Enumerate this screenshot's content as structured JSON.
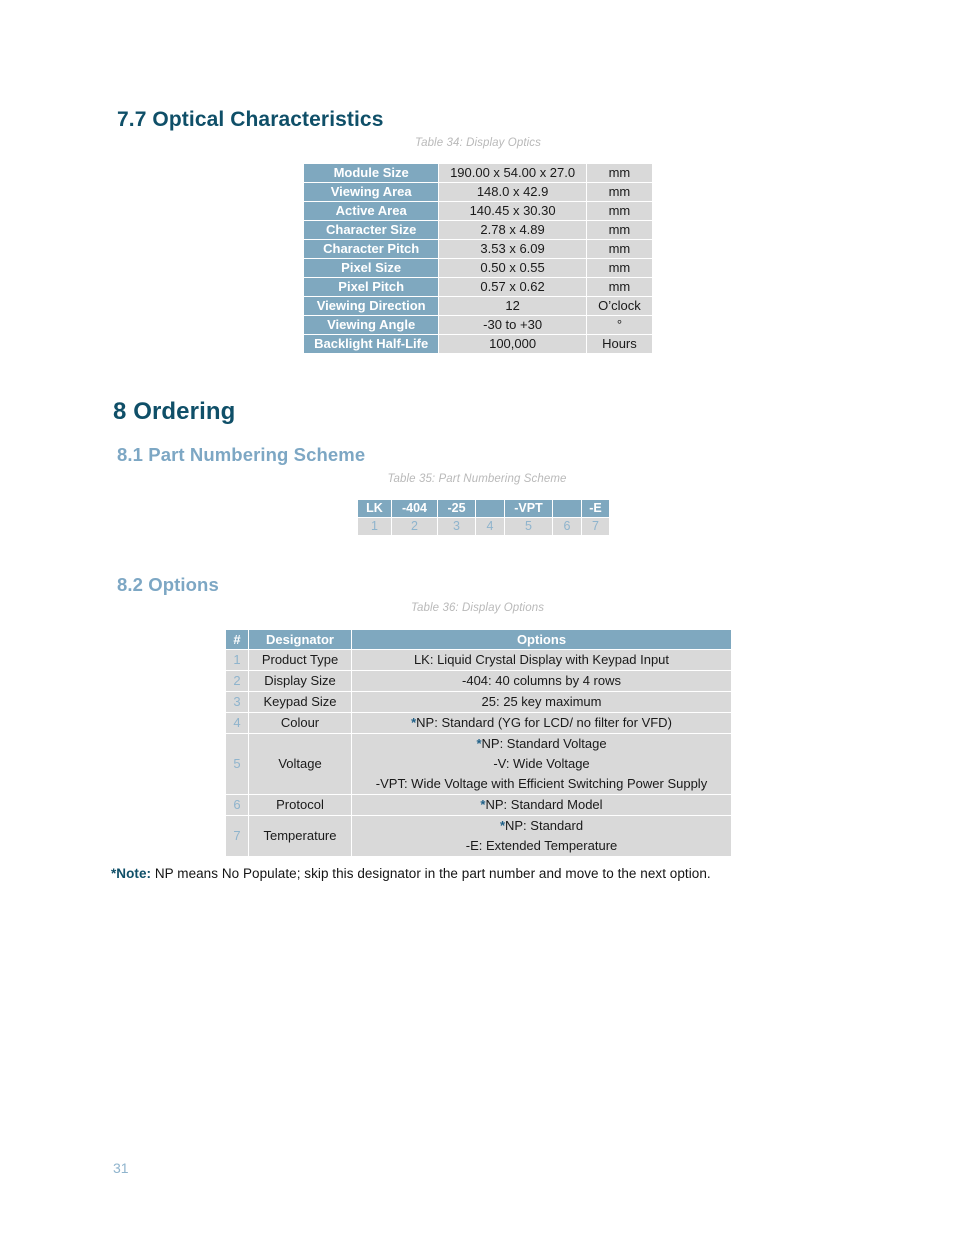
{
  "sections": {
    "optical": {
      "number": "7.7",
      "title": "Optical Characteristics",
      "heading": "7.7 Optical Characteristics"
    },
    "ordering": {
      "number": "8",
      "title": "Ordering",
      "heading": "8 Ordering"
    },
    "part_numbering": {
      "number": "8.1",
      "title": "Part Numbering Scheme",
      "heading": "8.1 Part Numbering Scheme"
    },
    "options": {
      "number": "8.2",
      "title": "Options",
      "heading": "8.2 Options"
    }
  },
  "table34": {
    "caption": "Table 34: Display Optics",
    "rows": [
      {
        "label": "Module Size",
        "value": "190.00 x 54.00 x 27.0",
        "unit": "mm"
      },
      {
        "label": "Viewing Area",
        "value": "148.0 x 42.9",
        "unit": "mm"
      },
      {
        "label": "Active Area",
        "value": "140.45 x 30.30",
        "unit": "mm"
      },
      {
        "label": "Character Size",
        "value": "2.78 x 4.89",
        "unit": "mm"
      },
      {
        "label": "Character Pitch",
        "value": "3.53 x 6.09",
        "unit": "mm"
      },
      {
        "label": "Pixel Size",
        "value": "0.50 x 0.55",
        "unit": "mm"
      },
      {
        "label": "Pixel Pitch",
        "value": "0.57 x 0.62",
        "unit": "mm"
      },
      {
        "label": "Viewing Direction",
        "value": "12",
        "unit": "O’clock"
      },
      {
        "label": "Viewing Angle",
        "value": "-30 to +30",
        "unit": "°"
      },
      {
        "label": "Backlight Half-Life",
        "value": "100,000",
        "unit": "Hours"
      }
    ]
  },
  "table35": {
    "caption": "Table 35: Part Numbering Scheme",
    "codes": [
      "LK",
      "-404",
      "-25",
      "",
      "-VPT",
      "",
      "-E"
    ],
    "indices": [
      "1",
      "2",
      "3",
      "4",
      "5",
      "6",
      "7"
    ]
  },
  "table36": {
    "caption": "Table 36: Display Options",
    "headers": {
      "num": "#",
      "designator": "Designator",
      "options": "Options"
    },
    "rows": [
      {
        "num": "1",
        "designator": "Product Type",
        "options": [
          "LK: Liquid Crystal Display with Keypad Input"
        ]
      },
      {
        "num": "2",
        "designator": "Display Size",
        "options": [
          "-404: 40 columns by 4 rows"
        ]
      },
      {
        "num": "3",
        "designator": "Keypad Size",
        "options": [
          "25: 25 key maximum"
        ]
      },
      {
        "num": "4",
        "designator": "Colour",
        "options": [
          "*NP: Standard (YG for LCD/ no filter for VFD)"
        ]
      },
      {
        "num": "5",
        "designator": "Voltage",
        "options": [
          "*NP: Standard Voltage",
          "-V: Wide Voltage",
          "-VPT: Wide Voltage with Efficient Switching Power Supply"
        ]
      },
      {
        "num": "6",
        "designator": "Protocol",
        "options": [
          "*NP: Standard Model"
        ]
      },
      {
        "num": "7",
        "designator": "Temperature",
        "options": [
          "*NP: Standard",
          "-E: Extended Temperature"
        ]
      }
    ]
  },
  "note": {
    "label": "*Note:",
    "text": " NP means No Populate; skip this designator in the part number and move to the next option."
  },
  "footer": {
    "page_number": "31"
  },
  "colors": {
    "header_blue": "#7fa8bf",
    "cell_gray": "#d9d9d9",
    "heading_dark": "#0f4f68",
    "heading_light": "#7da7c4",
    "caption_gray": "#b9b9b9",
    "index_blue": "#8fb4cd"
  }
}
